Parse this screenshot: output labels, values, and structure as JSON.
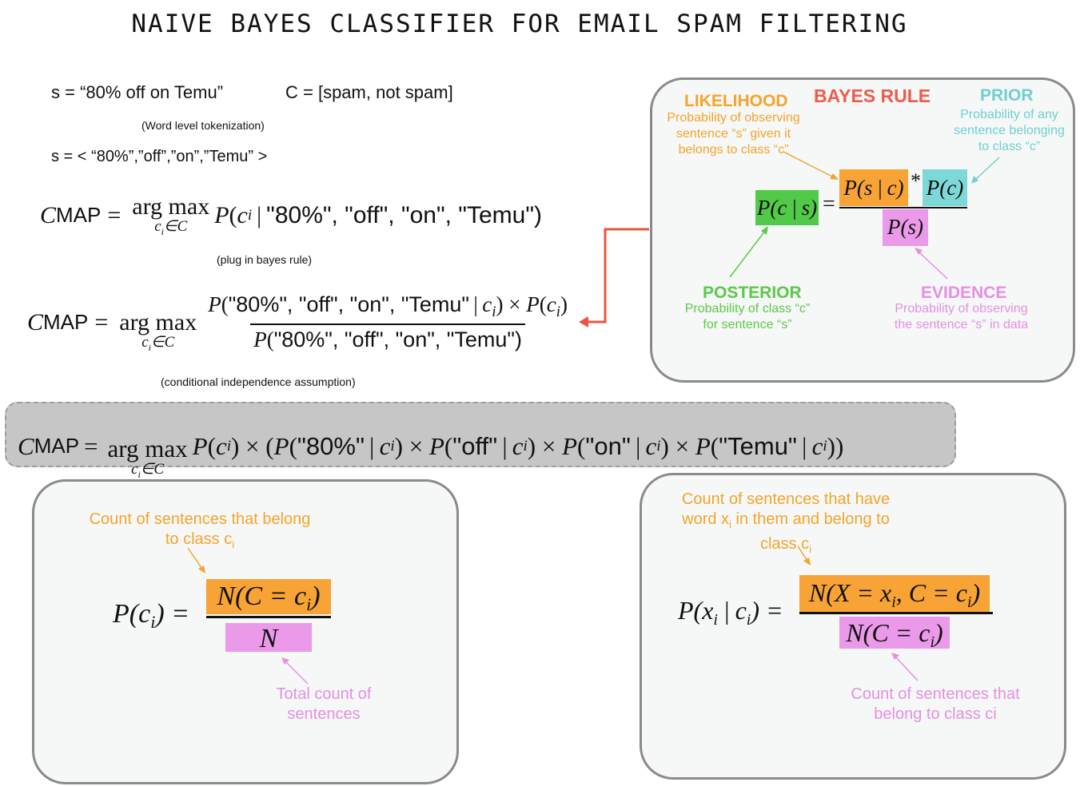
{
  "title": "NAIVE BAYES CLASSIFIER FOR EMAIL SPAM FILTERING",
  "intro": {
    "sentence": "s = “80% off on Temu”",
    "classes": "C = [spam, not spam]",
    "tokenization_note": "(Word level tokenization)",
    "tokens": "s = < “80%”,”off”,”on”,”Temu” >",
    "bayes_note": "(plug in bayes rule)",
    "independence_note": "(conditional independence assumption)"
  },
  "math": {
    "C": "C",
    "MAP": "MAP",
    "argmax": "arg max",
    "argsub": "c",
    "argsub_i": "i",
    "argsub_rest": "∈C",
    "eq1_rest": "\"80%\", \"off\", \"on\", \"Temu\")",
    "eq2_num_words": "\"80%\", \"off\", \"on\", \"Temu\"",
    "eq2_den": "\"80%\", \"off\", \"on\", \"Temu\")",
    "eq3_w1": "\"80%\"",
    "eq3_w2": "\"off\"",
    "eq3_w3": "\"on\"",
    "eq3_w4": "\"Temu\""
  },
  "bayes_rule": {
    "title": "BAYES RULE",
    "likelihood_title": "LIKELIHOOD",
    "likelihood_desc": [
      "Probability of observing",
      "sentence “s” given it",
      "belongs to class “c”"
    ],
    "prior_title": "PRIOR",
    "prior_desc": [
      "Probability of any",
      "sentence belonging",
      "to class “c”"
    ],
    "posterior_title": "POSTERIOR",
    "posterior_desc": [
      "Probability of class “c”",
      "for sentence “s”"
    ],
    "evidence_title": "EVIDENCE",
    "evidence_desc": [
      "Probability of observing",
      "the sentence “s” in data"
    ]
  },
  "prior_box": {
    "top_note": [
      "Count of sentences that belong",
      "to class c",
      "i"
    ],
    "bottom_note": [
      "Total count of",
      "sentences"
    ],
    "num": "N(C = c",
    "den": "N"
  },
  "likelihood_box": {
    "top_note": [
      "Count of sentences that  have",
      "word x",
      "i",
      " in them and belong to",
      "class c",
      "i"
    ],
    "bottom_note": [
      "Count of sentences that",
      "belong to class ci"
    ],
    "num": "N(X = x",
    "den": "N(C = c"
  },
  "colors": {
    "orange": "#f7a335",
    "teal": "#7dd9d7",
    "green": "#53c94a",
    "pink": "#ea9ae9",
    "red_arrow": "#e9553f"
  }
}
